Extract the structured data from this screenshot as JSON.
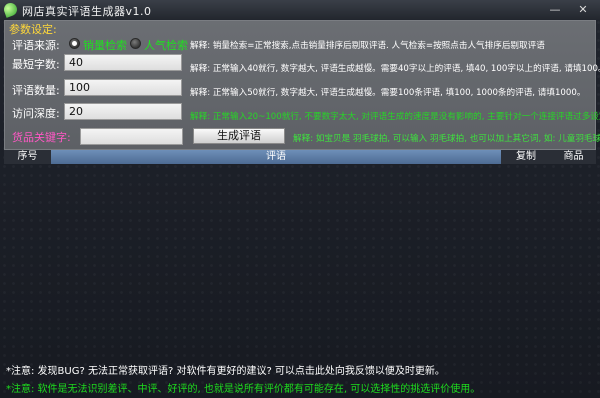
{
  "window": {
    "title": "网店真实评语生成器v1.0",
    "minimize": "—",
    "close": "✕"
  },
  "params": {
    "section_title": "参数设定:",
    "source": {
      "label": "评语来源:",
      "option1": "销量检索",
      "option2": "人气检索",
      "selected": "销量检索",
      "hint": "解释: 销量检索=正常搜索,点击销量排序后剔取评语. 人气检索=按照点击人气排序后剔取评语"
    },
    "min_chars": {
      "label": "最短字数:",
      "value": "40",
      "hint": "解释: 正常输入40就行, 数字越大, 评语生成越慢。需要40字以上的评语, 填40, 100字以上的评语, 请填100。"
    },
    "review_count": {
      "label": "评语数量:",
      "value": "100",
      "hint": "解释: 正常输入50就行, 数字越大, 评语生成越慢。需要100条评语, 填100, 1000条的评语, 请填1000。"
    },
    "depth": {
      "label": "访问深度:",
      "value": "20",
      "hint": "解释: 正常输入20~100就行, 不要数字太大, 对评语生成的速度是没有影响的, 主要针对一个连接评语过多设定的。"
    },
    "keyword": {
      "label": "货品关键字:",
      "value": "",
      "hint": "解释: 如宝贝是 羽毛球拍, 可以输入 羽毛球拍, 也可以加上其它词, 如: 儿童羽毛球拍"
    },
    "generate_button": "生成评语"
  },
  "table": {
    "columns": [
      "序号",
      "评语",
      "复制",
      "商品"
    ]
  },
  "notes": {
    "note1": "*注意: 发现BUG? 无法正常获取评语? 对软件有更好的建议? 可以点击此处向我反馈以便及时更新。",
    "note2": "*注意: 软件是无法识别差评、中评、好评的, 也就是说所有评价都有可能存在, 可以选择性的挑选评价使用。"
  },
  "colors": {
    "section_title": "#ffd83a",
    "radio_text": "#1fe11f",
    "keyword_label": "#ff58c5",
    "header_highlight": "#5b7ba5"
  }
}
